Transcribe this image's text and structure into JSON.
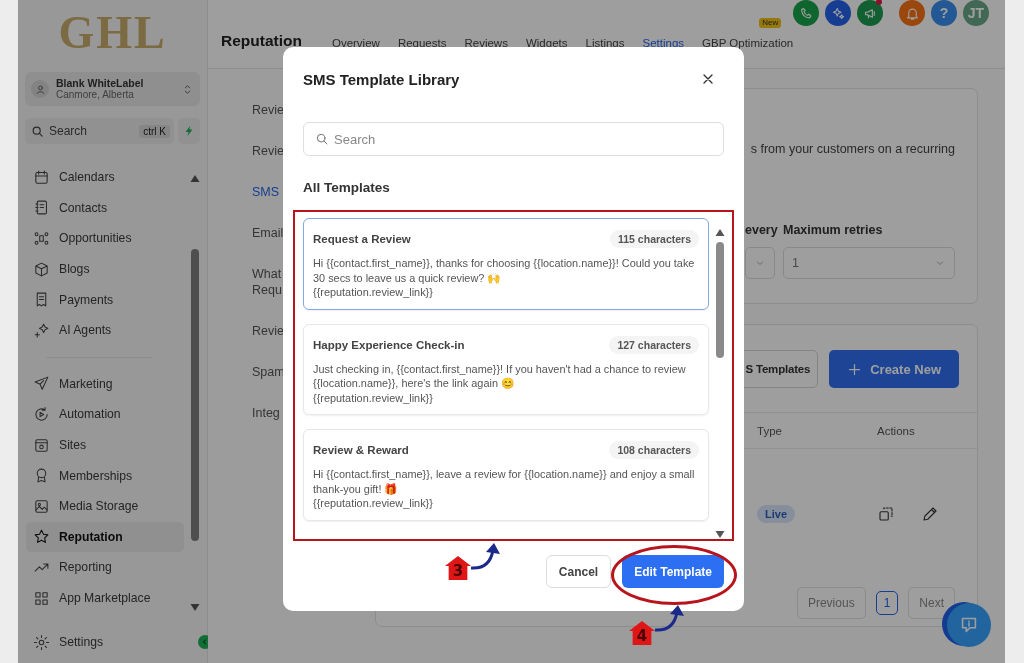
{
  "logo": {
    "text": "GHL"
  },
  "header_icons": [
    {
      "kind": "phone"
    },
    {
      "kind": "sparkle"
    },
    {
      "kind": "megaphone",
      "dot": true
    },
    {
      "kind": "bell"
    },
    {
      "kind": "help",
      "label": "?"
    },
    {
      "kind": "avatar",
      "label": "JT"
    }
  ],
  "account": {
    "name": "Blank WhiteLabel",
    "location": "Canmore, Alberta"
  },
  "sidebar_search": {
    "placeholder": "Search",
    "shortcut": "ctrl K"
  },
  "nav_groups": [
    [
      {
        "label": "Calendars",
        "kind": "calendar",
        "selected": false
      },
      {
        "label": "Contacts",
        "kind": "contacts",
        "selected": false
      },
      {
        "label": "Opportunities",
        "kind": "opportunities",
        "selected": false
      },
      {
        "label": "Blogs",
        "kind": "blogs",
        "selected": false
      },
      {
        "label": "Payments",
        "kind": "payments",
        "selected": false
      },
      {
        "label": "AI Agents",
        "kind": "ai",
        "selected": false
      }
    ],
    [
      {
        "label": "Marketing",
        "kind": "marketing",
        "selected": false
      },
      {
        "label": "Automation",
        "kind": "automation",
        "selected": false
      },
      {
        "label": "Sites",
        "kind": "sites",
        "selected": false
      },
      {
        "label": "Memberships",
        "kind": "memberships",
        "selected": false
      },
      {
        "label": "Media Storage",
        "kind": "media",
        "selected": false
      },
      {
        "label": "Reputation",
        "kind": "reputation",
        "selected": true
      },
      {
        "label": "Reporting",
        "kind": "reporting",
        "selected": false
      },
      {
        "label": "App Marketplace",
        "kind": "marketplace",
        "selected": false
      }
    ]
  ],
  "settings_link": {
    "label": "Settings"
  },
  "page_title": "Reputation",
  "tabs": [
    {
      "label": "Overview",
      "selected": false
    },
    {
      "label": "Requests",
      "selected": false
    },
    {
      "label": "Reviews",
      "selected": false
    },
    {
      "label": "Widgets",
      "selected": false
    },
    {
      "label": "Listings",
      "selected": false
    },
    {
      "label": "Settings",
      "selected": true
    },
    {
      "label": "GBP Optimization",
      "selected": false,
      "badge": "New"
    }
  ],
  "settings_nav": [
    {
      "label": "Revie",
      "selected": false
    },
    {
      "label": "Revie",
      "selected": false
    },
    {
      "label": "SMS",
      "selected": true
    },
    {
      "label": "Email",
      "selected": false
    },
    {
      "label": "What Requ",
      "selected": false
    },
    {
      "label": "Revie",
      "selected": false
    },
    {
      "label": "Spam",
      "selected": false
    },
    {
      "label": "Integ",
      "selected": false
    }
  ],
  "settings_card": {
    "description": "s from your customers on a recurring",
    "fields": [
      {
        "label": "every"
      },
      {
        "label": "Maximum retries",
        "value": "1"
      }
    ]
  },
  "templates_card": {
    "buttons": [
      {
        "label": "S Templates",
        "kind": "outline"
      },
      {
        "label": "Create New",
        "kind": "primary"
      }
    ],
    "columns": [
      "Type",
      "Actions"
    ],
    "rows": [
      {
        "type": "Live"
      }
    ],
    "pagination": {
      "previous": "Previous",
      "page": "1",
      "next": "Next"
    }
  },
  "modal": {
    "title": "SMS Template Library",
    "search_placeholder": "Search",
    "section": "All Templates",
    "templates": [
      {
        "name": "Request a Review",
        "count": "115 characters",
        "selected": true,
        "body": "Hi {{contact.first_name}}, thanks for choosing {{location.name}}! Could you take 30 secs to leave us a quick review? 🙌\n{{reputation.review_link}}"
      },
      {
        "name": "Happy Experience Check-in",
        "count": "127 characters",
        "selected": false,
        "body": "Just checking in, {{contact.first_name}}! If you haven't had a chance to review {{location.name}}, here's the link again 😊\n{{reputation.review_link}}"
      },
      {
        "name": "Review & Reward",
        "count": "108 characters",
        "selected": false,
        "body": "Hi {{contact.first_name}}, leave a review for {{location.name}} and enjoy a small thank-you gift! 🎁\n{{reputation.review_link}}"
      }
    ],
    "buttons": [
      {
        "label": "Cancel",
        "kind": "secondary"
      },
      {
        "label": "Edit Template",
        "kind": "primary"
      }
    ]
  },
  "annotations": [
    {
      "label": "3"
    },
    {
      "label": "4"
    }
  ]
}
